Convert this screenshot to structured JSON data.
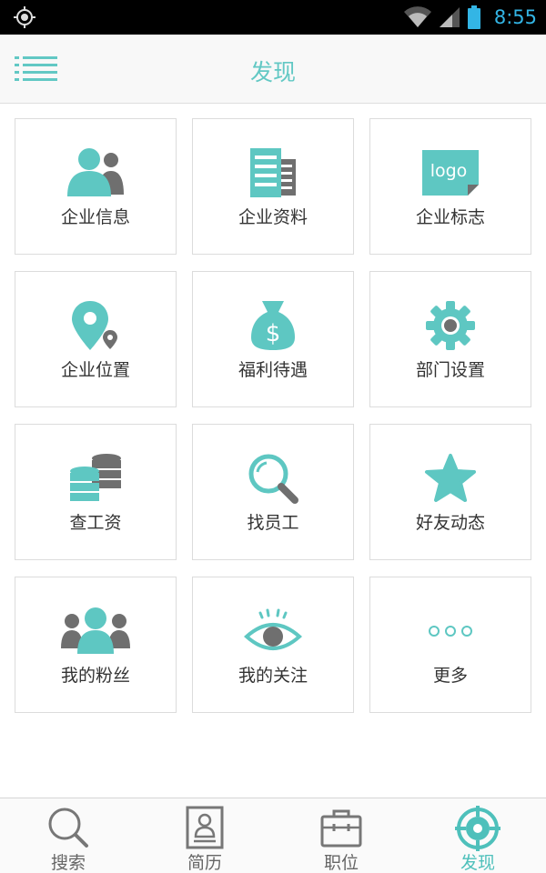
{
  "status_bar": {
    "time": "8:55",
    "icons": [
      "gps-icon",
      "wifi-icon",
      "signal-icon",
      "battery-icon"
    ]
  },
  "header": {
    "title": "发现",
    "menu_icon": "menu-icon"
  },
  "grid": [
    {
      "label": "企业信息",
      "icon": "company-info-icon"
    },
    {
      "label": "企业资料",
      "icon": "company-docs-icon"
    },
    {
      "label": "企业标志",
      "icon": "logo-icon",
      "icon_text": "logo"
    },
    {
      "label": "企业位置",
      "icon": "location-pin-icon"
    },
    {
      "label": "福利待遇",
      "icon": "money-bag-icon"
    },
    {
      "label": "部门设置",
      "icon": "gear-icon"
    },
    {
      "label": "查工资",
      "icon": "coins-icon"
    },
    {
      "label": "找员工",
      "icon": "magnifier-icon"
    },
    {
      "label": "好友动态",
      "icon": "star-icon"
    },
    {
      "label": "我的粉丝",
      "icon": "fans-icon"
    },
    {
      "label": "我的关注",
      "icon": "eye-icon"
    },
    {
      "label": "更多",
      "icon": "more-dots-icon"
    }
  ],
  "bottom_nav": [
    {
      "label": "搜索",
      "icon": "search-icon",
      "active": false
    },
    {
      "label": "简历",
      "icon": "resume-icon",
      "active": false
    },
    {
      "label": "职位",
      "icon": "briefcase-icon",
      "active": false
    },
    {
      "label": "发现",
      "icon": "discover-icon",
      "active": true
    }
  ],
  "colors": {
    "accent": "#62c8c4",
    "icon_teal": "#5ec7c2",
    "icon_gray": "#6f6f6f",
    "time_blue": "#33b5e5",
    "border": "#dcdcdc"
  }
}
